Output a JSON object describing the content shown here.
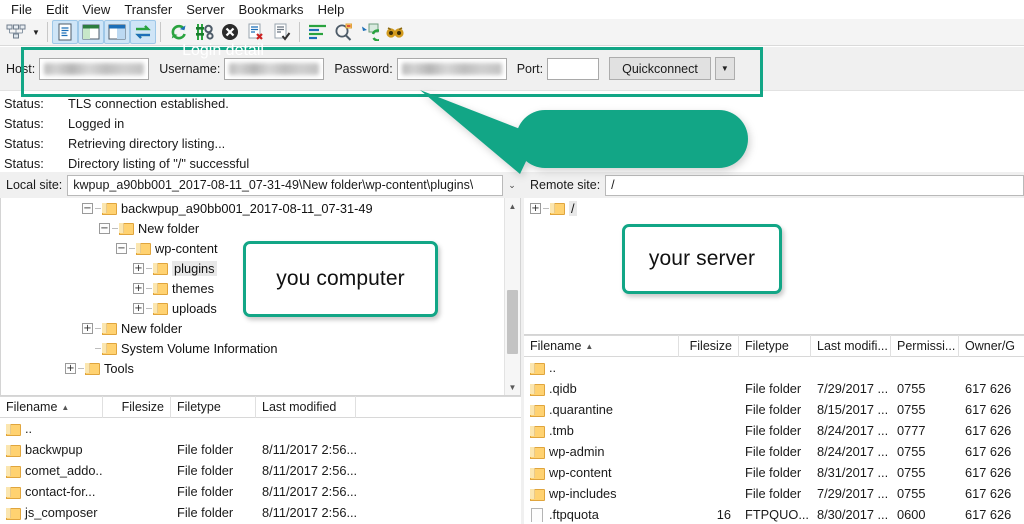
{
  "app": {
    "menu": [
      "File",
      "Edit",
      "View",
      "Transfer",
      "Server",
      "Bookmarks",
      "Help"
    ],
    "accent_color": "#12a686"
  },
  "toolbar": {
    "items": [
      {
        "name": "site-manager-icon",
        "active": false
      },
      {
        "name": "site-manager-dropdown-icon",
        "active": false
      },
      {
        "name": "toggle-message-log-icon",
        "active": true
      },
      {
        "name": "toggle-local-tree-icon",
        "active": true
      },
      {
        "name": "toggle-remote-tree-icon",
        "active": true
      },
      {
        "name": "toggle-transfer-queue-icon",
        "active": true
      },
      {
        "name": "refresh-icon",
        "active": false
      },
      {
        "name": "process-queue-icon",
        "active": false
      },
      {
        "name": "cancel-operation-icon",
        "active": false
      },
      {
        "name": "disconnect-icon",
        "active": false
      },
      {
        "name": "reconnect-icon",
        "active": false
      },
      {
        "name": "filter-icon",
        "active": false
      },
      {
        "name": "directory-comparison-icon",
        "active": false
      },
      {
        "name": "synchronized-browsing-icon",
        "active": false
      },
      {
        "name": "find-files-icon",
        "active": false
      }
    ]
  },
  "quickconnect": {
    "host_label": "Host:",
    "host_value": "",
    "username_label": "Username:",
    "username_value": "",
    "password_label": "Password:",
    "password_value": "",
    "port_label": "Port:",
    "port_value": "",
    "button_label": "Quickconnect",
    "dropdown_icon": "chevron-down-icon"
  },
  "status_log": {
    "entries": [
      {
        "key": "Status:",
        "message": "TLS connection established."
      },
      {
        "key": "Status:",
        "message": "Logged in"
      },
      {
        "key": "Status:",
        "message": "Retrieving directory listing..."
      },
      {
        "key": "Status:",
        "message": "Directory listing of \"/\" successful"
      }
    ]
  },
  "local": {
    "site_label": "Local site:",
    "site_path": "kwpup_a90bb001_2017-08-11_07-31-49\\New folder\\wp-content\\plugins\\",
    "tree": [
      {
        "label": "backwpup_a90bb001_2017-08-11_07-31-49",
        "depth": 1,
        "expander": "minus",
        "selected": false
      },
      {
        "label": "New folder",
        "depth": 2,
        "expander": "minus",
        "selected": false
      },
      {
        "label": "wp-content",
        "depth": 3,
        "expander": "minus",
        "selected": false
      },
      {
        "label": "plugins",
        "depth": 4,
        "expander": "plus",
        "selected": true
      },
      {
        "label": "themes",
        "depth": 4,
        "expander": "plus",
        "selected": false
      },
      {
        "label": "uploads",
        "depth": 4,
        "expander": "plus",
        "selected": false
      },
      {
        "label": "New folder",
        "depth": 1,
        "expander": "plus",
        "selected": false
      },
      {
        "label": "System Volume Information",
        "depth": 1,
        "expander": "none",
        "selected": false
      },
      {
        "label": "Tools",
        "depth": 0,
        "expander": "plus",
        "selected": false
      }
    ],
    "columns": [
      "Filename",
      "Filesize",
      "Filetype",
      "Last modified"
    ],
    "sort_column": "Filename",
    "rows": [
      {
        "icon": "folder-icon",
        "filename": "..",
        "filesize": "",
        "filetype": "",
        "modified": ""
      },
      {
        "icon": "folder-icon",
        "filename": "backwpup",
        "filesize": "",
        "filetype": "File folder",
        "modified": "8/11/2017 2:56..."
      },
      {
        "icon": "folder-icon",
        "filename": "comet_addo...",
        "filesize": "",
        "filetype": "File folder",
        "modified": "8/11/2017 2:56..."
      },
      {
        "icon": "folder-icon",
        "filename": "contact-for...",
        "filesize": "",
        "filetype": "File folder",
        "modified": "8/11/2017 2:56..."
      },
      {
        "icon": "folder-icon",
        "filename": "js_composer",
        "filesize": "",
        "filetype": "File folder",
        "modified": "8/11/2017 2:56..."
      }
    ]
  },
  "remote": {
    "site_label": "Remote site:",
    "site_path": "/",
    "tree": [
      {
        "label": "/",
        "depth": 0,
        "expander": "plus",
        "selected": true
      }
    ],
    "columns": [
      "Filename",
      "Filesize",
      "Filetype",
      "Last modifi...",
      "Permissi...",
      "Owner/G"
    ],
    "sort_column": "Filename",
    "rows": [
      {
        "icon": "folder-icon",
        "filename": "..",
        "filesize": "",
        "filetype": "",
        "modified": "",
        "permissions": "",
        "owner": ""
      },
      {
        "icon": "folder-icon",
        "filename": ".qidb",
        "filesize": "",
        "filetype": "File folder",
        "modified": "7/29/2017 ...",
        "permissions": "0755",
        "owner": "617 626"
      },
      {
        "icon": "folder-icon",
        "filename": ".quarantine",
        "filesize": "",
        "filetype": "File folder",
        "modified": "8/15/2017 ...",
        "permissions": "0755",
        "owner": "617 626"
      },
      {
        "icon": "folder-icon",
        "filename": ".tmb",
        "filesize": "",
        "filetype": "File folder",
        "modified": "8/24/2017 ...",
        "permissions": "0777",
        "owner": "617 626"
      },
      {
        "icon": "folder-icon",
        "filename": "wp-admin",
        "filesize": "",
        "filetype": "File folder",
        "modified": "8/24/2017 ...",
        "permissions": "0755",
        "owner": "617 626"
      },
      {
        "icon": "folder-icon",
        "filename": "wp-content",
        "filesize": "",
        "filetype": "File folder",
        "modified": "8/31/2017 ...",
        "permissions": "0755",
        "owner": "617 626"
      },
      {
        "icon": "folder-icon",
        "filename": "wp-includes",
        "filesize": "",
        "filetype": "File folder",
        "modified": "7/29/2017 ...",
        "permissions": "0755",
        "owner": "617 626"
      },
      {
        "icon": "file-icon",
        "filename": ".ftpquota",
        "filesize": "16",
        "filetype": "FTPQUO...",
        "modified": "8/30/2017 ...",
        "permissions": "0600",
        "owner": "617 626"
      }
    ]
  },
  "annotations": {
    "login_detail": "Login detail",
    "your_computer": "you computer",
    "your_server": "your server"
  }
}
